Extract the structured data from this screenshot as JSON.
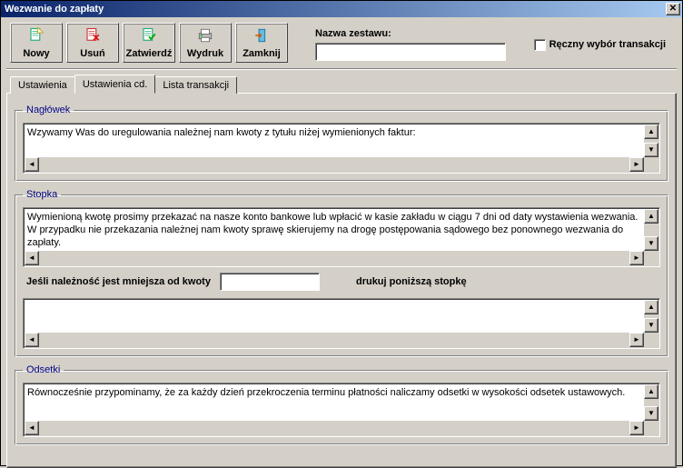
{
  "title": "Wezwanie do zapłaty",
  "toolbar": {
    "nowy": "Nowy",
    "usun": "Usuń",
    "zatwierdz": "Zatwierdź",
    "wydruk": "Wydruk",
    "zamknij": "Zamknij"
  },
  "set": {
    "name_label": "Nazwa zestawu:",
    "name_value": "",
    "manual_label": "Ręczny wybór transakcji"
  },
  "tabs": {
    "ustawienia": "Ustawienia",
    "ustawienia_cd": "Ustawienia cd.",
    "lista": "Lista transakcji"
  },
  "groups": {
    "naglowek": {
      "legend": "Nagłówek",
      "text": "Wzywamy Was do uregulowania należnej nam kwoty z tytułu niżej wymienionych faktur:"
    },
    "stopka": {
      "legend": "Stopka",
      "text": "Wymienioną kwotę prosimy przekazać na nasze konto bankowe lub wpłacić w kasie zakładu w ciągu 7 dni od daty wystawienia wezwania. W przypadku nie przekazania należnej nam kwoty sprawę skierujemy na drogę postępowania sądowego bez ponownego wezwania do zapłaty.",
      "threshold_label": "Jeśli należność jest mniejsza od kwoty",
      "threshold_value": "",
      "alt_label": "drukuj poniższą stopkę",
      "alt_text": ""
    },
    "odsetki": {
      "legend": "Odsetki",
      "text": "Równocześnie przypominamy, że za każdy dzień przekroczenia terminu płatności naliczamy odsetki w wysokości odsetek ustawowych."
    }
  }
}
